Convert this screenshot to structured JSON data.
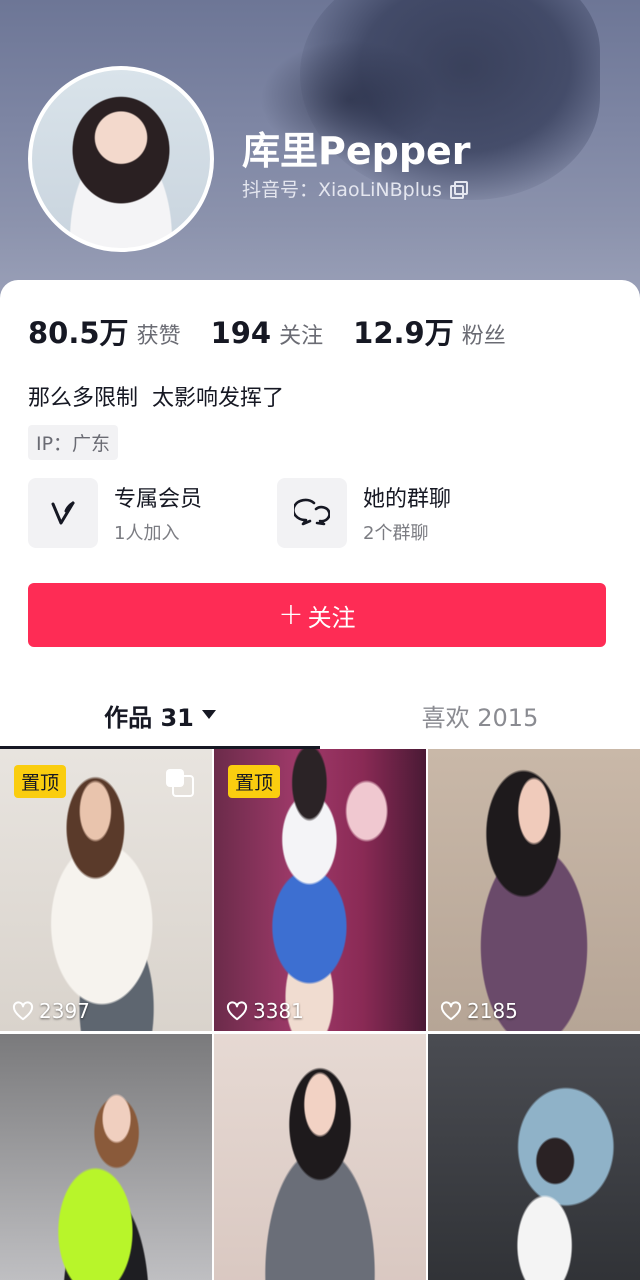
{
  "profile": {
    "username": "库里Pepper",
    "douyin_id": "抖音号：XiaoLiNBplus"
  },
  "stats": [
    {
      "num": "80.5万",
      "label": "获赞"
    },
    {
      "num": "194",
      "label": "关注"
    },
    {
      "num": "12.9万",
      "label": "粉丝"
    }
  ],
  "bio": "那么多限制  太影响发挥了",
  "ip_tag": "IP：广东",
  "features": [
    {
      "title": "专属会员",
      "sub": "1人加入",
      "icon": "vip-v-icon"
    },
    {
      "title": "她的群聊",
      "sub": "2个群聊",
      "icon": "group-chat-icon"
    }
  ],
  "follow_button": {
    "plus": "+",
    "label": "关注"
  },
  "tabs": {
    "works": "作品 31",
    "likes": "喜欢 2015"
  },
  "grid": [
    {
      "pinned": true,
      "pin_label": "置顶",
      "multi": true,
      "likes": "2397"
    },
    {
      "pinned": true,
      "pin_label": "置顶",
      "multi": false,
      "likes": "3381"
    },
    {
      "pinned": false,
      "multi": false,
      "likes": "2185"
    },
    {
      "pinned": false,
      "multi": false,
      "likes": ""
    },
    {
      "pinned": false,
      "multi": false,
      "likes": ""
    },
    {
      "pinned": false,
      "multi": false,
      "likes": ""
    }
  ],
  "colors": {
    "accent": "#fe2c55",
    "pin": "#facd0f",
    "header_bg": "#7d85a3"
  }
}
